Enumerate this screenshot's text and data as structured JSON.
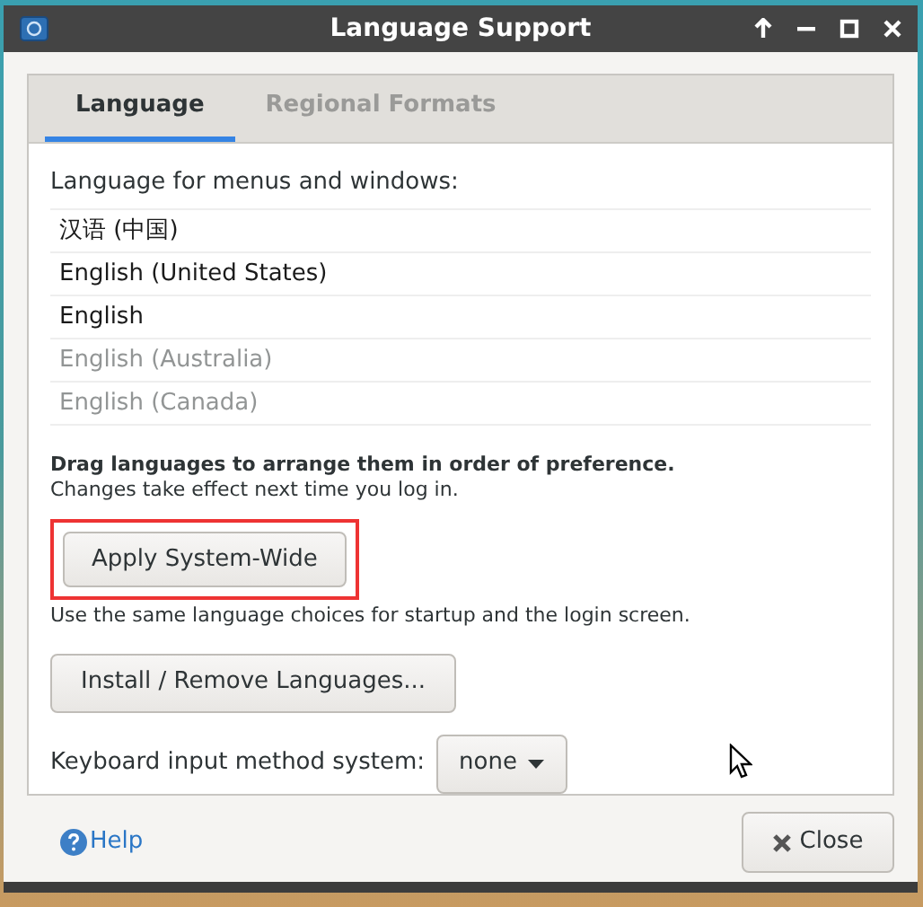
{
  "window": {
    "title": "Language Support"
  },
  "tabs": [
    {
      "label": "Language",
      "selected": true
    },
    {
      "label": "Regional Formats",
      "selected": false
    }
  ],
  "language_section": {
    "heading": "Language for menus and windows:",
    "languages": [
      {
        "name": "汉语 (中国)",
        "disabled": false
      },
      {
        "name": "English (United States)",
        "disabled": false
      },
      {
        "name": "English",
        "disabled": false
      },
      {
        "name": "English (Australia)",
        "disabled": true
      },
      {
        "name": "English (Canada)",
        "disabled": true
      }
    ],
    "hint_bold": "Drag languages to arrange them in order of preference.",
    "hint": "Changes take effect next time you log in."
  },
  "apply_button": {
    "label": "Apply System-Wide",
    "highlighted": true
  },
  "apply_note": "Use the same language choices for startup and the login screen.",
  "install_button": {
    "label": "Install / Remove Languages..."
  },
  "input_method": {
    "label": "Keyboard input method system:",
    "value": "none"
  },
  "footer": {
    "help": "Help",
    "close": "Close"
  }
}
